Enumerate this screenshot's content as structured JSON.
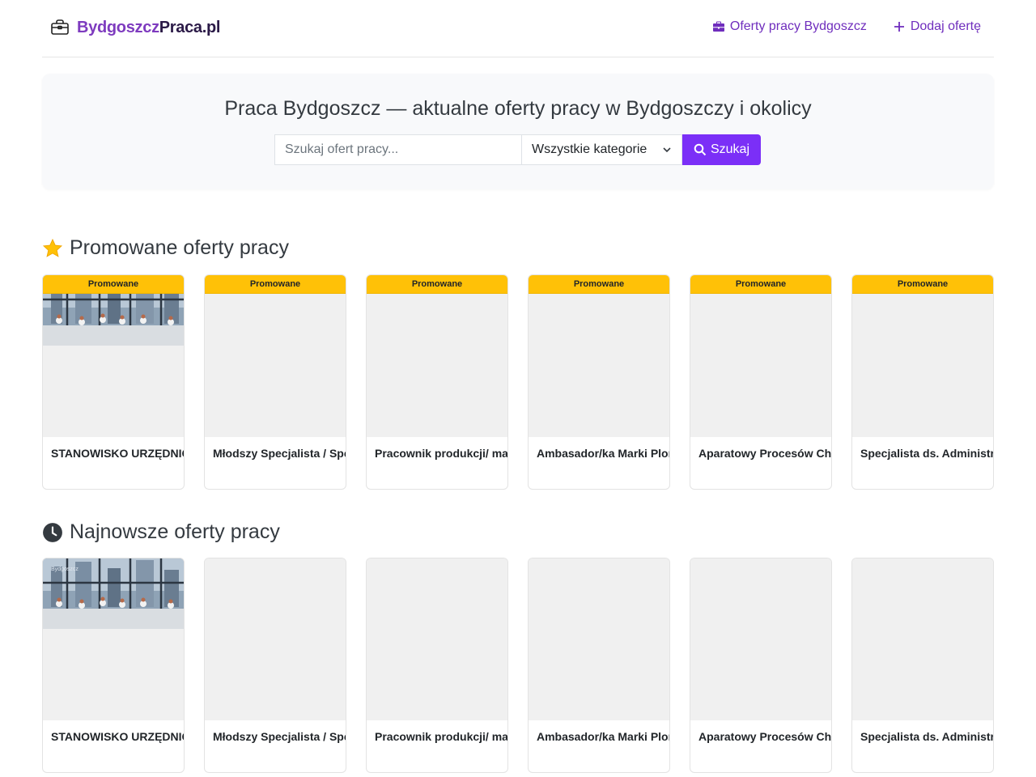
{
  "navbar": {
    "brand_part1": "Bydgoszcz",
    "brand_part2": "Praca.pl",
    "links": [
      {
        "label": "Oferty pracy Bydgoszcz",
        "icon": "briefcase-icon"
      },
      {
        "label": "Dodaj ofertę",
        "icon": "plus-icon"
      }
    ]
  },
  "hero": {
    "title": "Praca Bydgoszcz — aktualne oferty pracy w Bydgoszczy i okolicy",
    "search_placeholder": "Szukaj ofert pracy...",
    "search_value": "",
    "category_selected": "Wszystkie kategorie",
    "search_button": "Szukaj"
  },
  "promoted": {
    "title": "Promowane oferty pracy",
    "badge": "Promowane",
    "cards": [
      {
        "title": "STANOWISKO URZĘDNICZE",
        "has_image": true
      },
      {
        "title": "Młodszy Specjalista / Specjalista",
        "has_image": false
      },
      {
        "title": "Pracownik produkcji/ magazynu",
        "has_image": false
      },
      {
        "title": "Ambasador/ka Marki Plonus",
        "has_image": false
      },
      {
        "title": "Aparatowy Procesów Chemicznych",
        "has_image": false
      },
      {
        "title": "Specjalista ds. Administracyjnych",
        "has_image": false
      }
    ]
  },
  "latest": {
    "title": "Najnowsze oferty pracy",
    "photo_label": "Bydgoszcz",
    "cards": [
      {
        "title": "STANOWISKO URZĘDNICZE",
        "has_image": true
      },
      {
        "title": "Młodszy Specjalista / Specjalista",
        "has_image": false
      },
      {
        "title": "Pracownik produkcji/ magazynu",
        "has_image": false
      },
      {
        "title": "Ambasador/ka Marki Plonus",
        "has_image": false
      },
      {
        "title": "Aparatowy Procesów Chemicznych",
        "has_image": false
      },
      {
        "title": "Specjalista ds. Administracyjnych",
        "has_image": false
      }
    ]
  },
  "colors": {
    "accent": "#7b2ff7",
    "link": "#6f2dbd",
    "badge": "#ffc107",
    "brand_purple": "#7e3bbf",
    "brand_dark": "#2b1a47"
  }
}
